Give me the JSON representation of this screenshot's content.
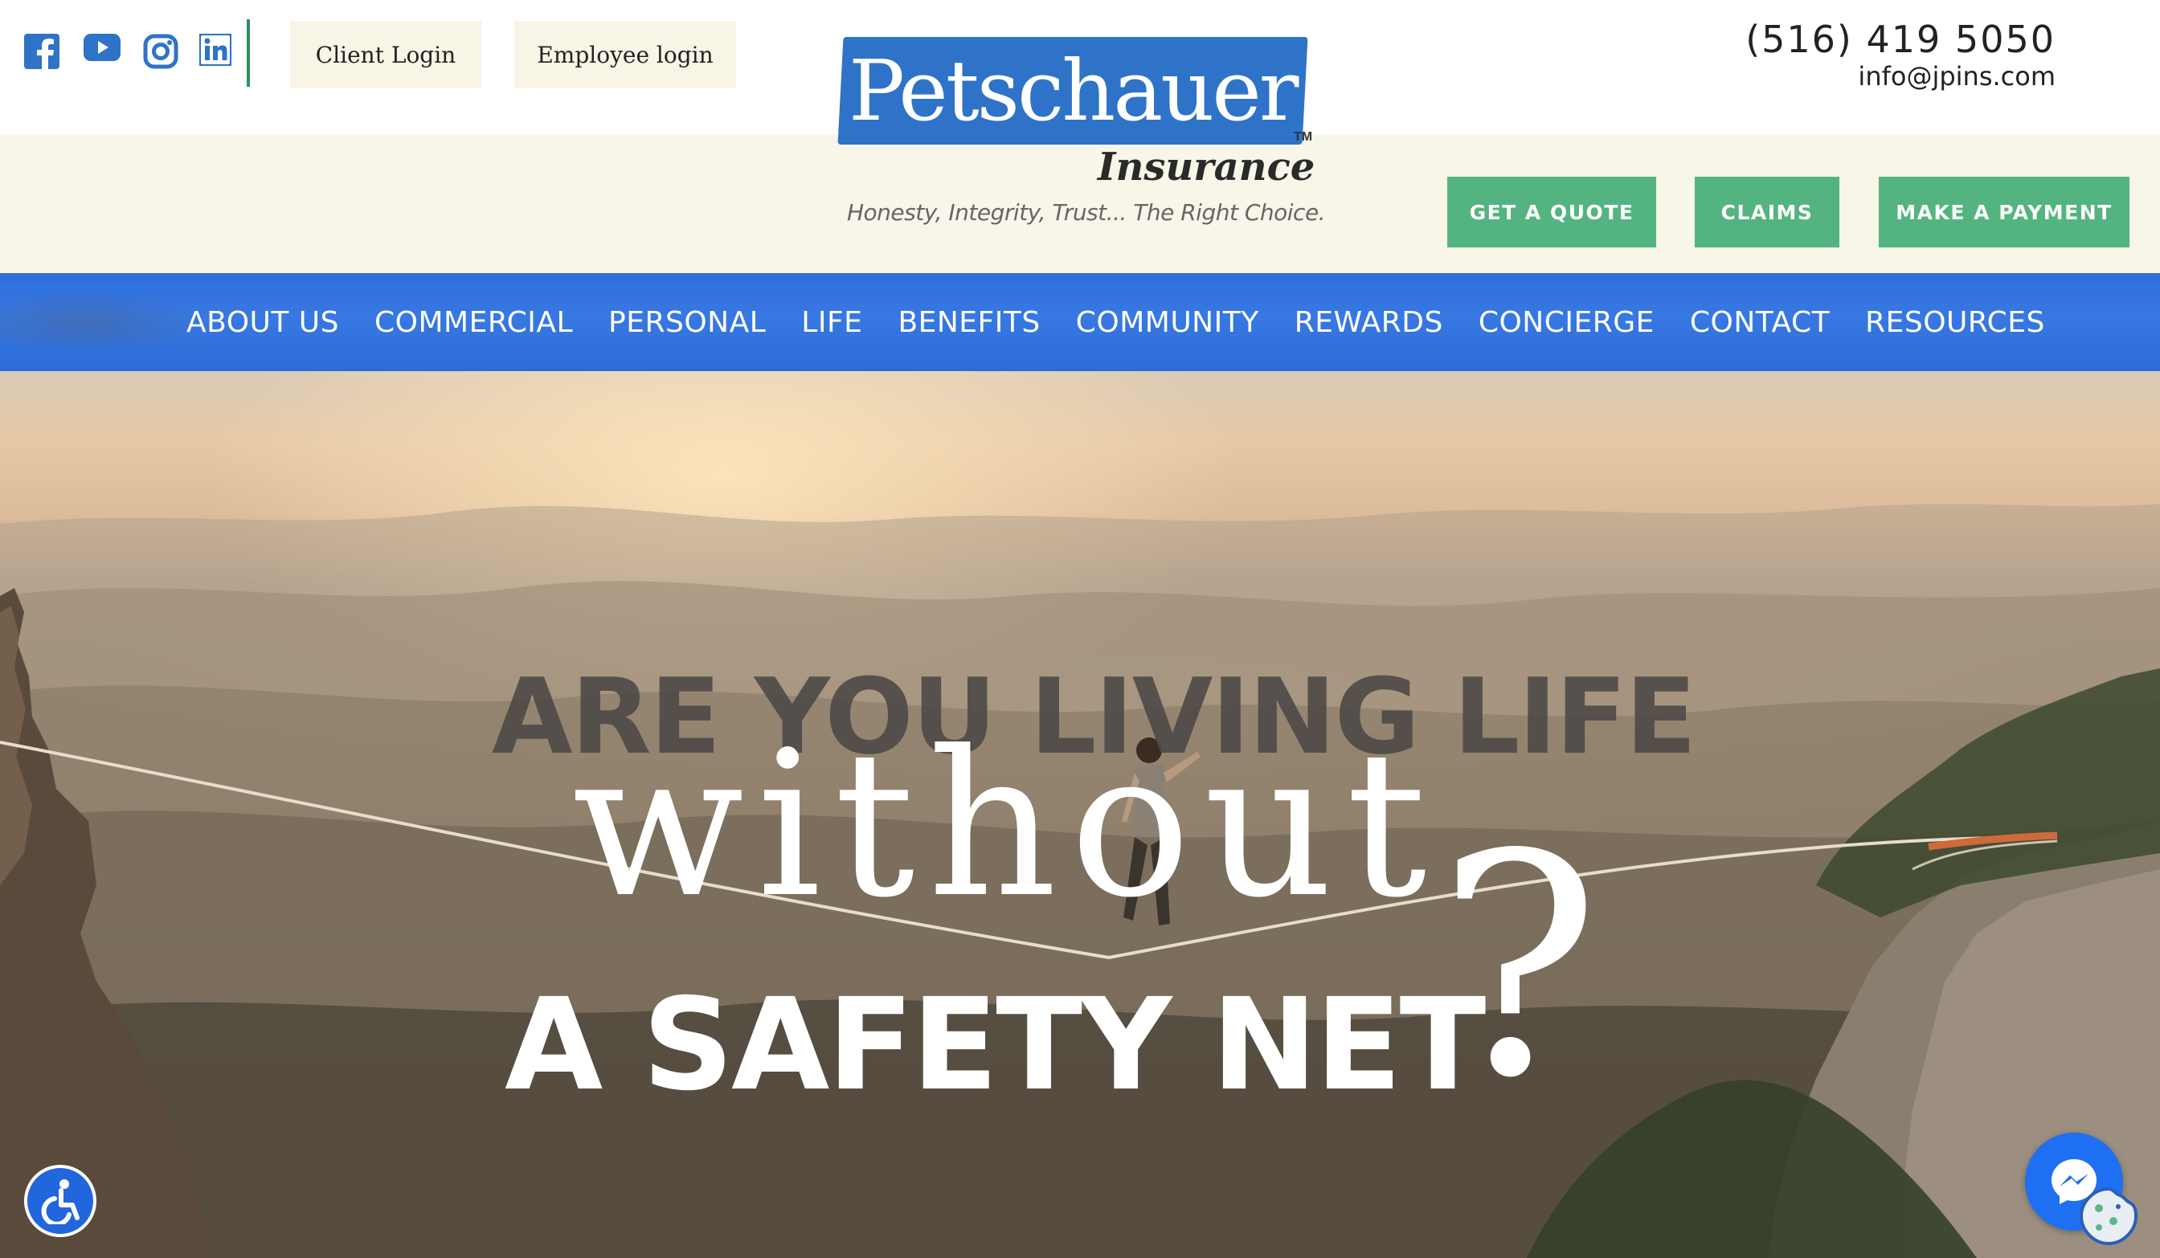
{
  "social": {
    "icons": [
      "facebook-icon",
      "youtube-icon",
      "instagram-icon",
      "linkedin-icon"
    ],
    "icon_color": "#2e73c8"
  },
  "header": {
    "client_login": "Client Login",
    "employee_login": "Employee login",
    "phone": "(516) 419 5050",
    "email": "info@jpins.com"
  },
  "logo": {
    "name": "Petschauer",
    "tm": "TM",
    "subtitle": "Insurance",
    "tagline": "Honesty, Integrity, Trust... The Right Choice."
  },
  "cta": {
    "quote": "GET A QUOTE",
    "claims": "CLAIMS",
    "payment": "MAKE A PAYMENT",
    "color": "#54b481"
  },
  "nav": {
    "items": [
      "ABOUT US",
      "COMMERCIAL",
      "PERSONAL",
      "LIFE",
      "BENEFITS",
      "COMMUNITY",
      "REWARDS",
      "CONCIERGE",
      "CONTACT",
      "RESOURCES"
    ],
    "color": "#2e6fdc"
  },
  "hero": {
    "line1": "ARE YOU LIVING LIFE",
    "line2": "without",
    "line3": "A SAFETY NET",
    "question": "?"
  },
  "widgets": {
    "accessibility": "accessibility-icon",
    "messenger": "messenger-icon",
    "cookie": "cookie-icon"
  }
}
